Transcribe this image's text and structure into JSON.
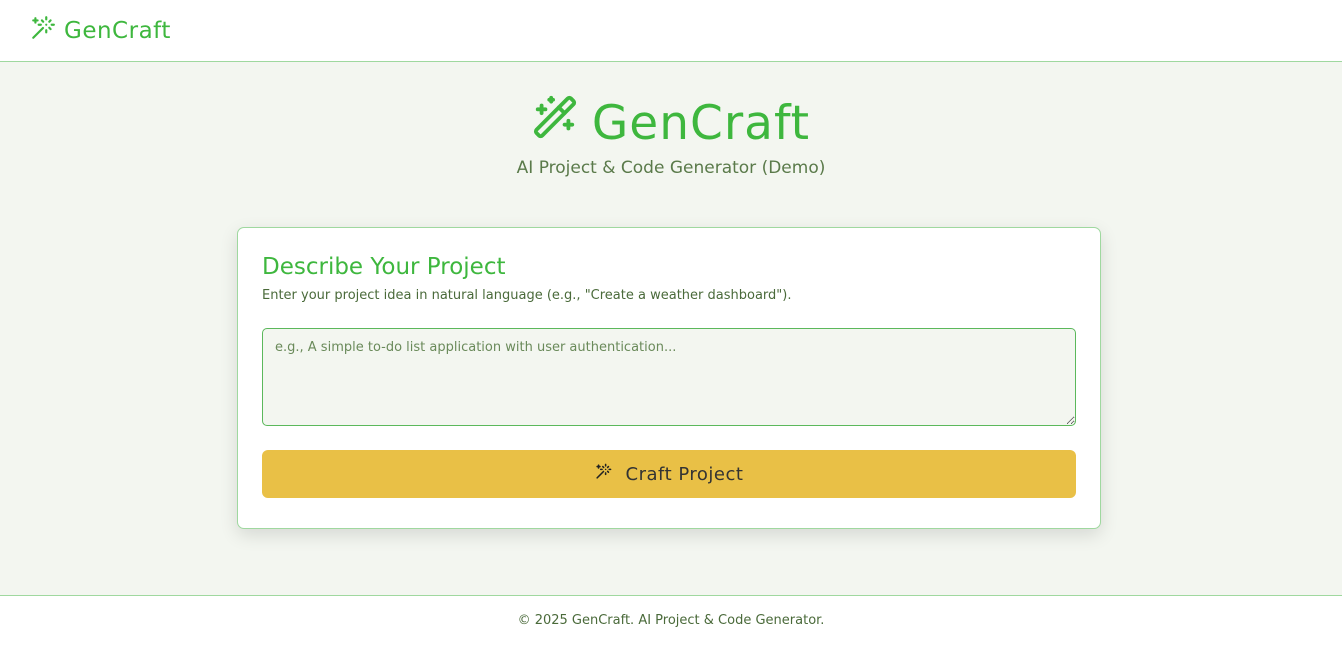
{
  "header": {
    "brand_name": "GenCraft",
    "brand_icon": "magic-wand-icon"
  },
  "hero": {
    "title": "GenCraft",
    "subtitle": "AI Project & Code Generator (Demo)",
    "icon": "magic-wand-icon"
  },
  "card": {
    "title": "Describe Your Project",
    "description": "Enter your project idea in natural language (e.g., \"Create a weather dashboard\").",
    "prompt_placeholder": "e.g., A simple to-do list application with user authentication...",
    "prompt_value": "",
    "button_label": "Craft Project",
    "button_icon": "magic-wand-icon"
  },
  "footer": {
    "text": "© 2025 GenCraft. AI Project & Code Generator."
  },
  "colors": {
    "accent": "#3eb73e",
    "button": "#e9c046",
    "background": "#f3f6f0",
    "border": "#9fd89f"
  }
}
